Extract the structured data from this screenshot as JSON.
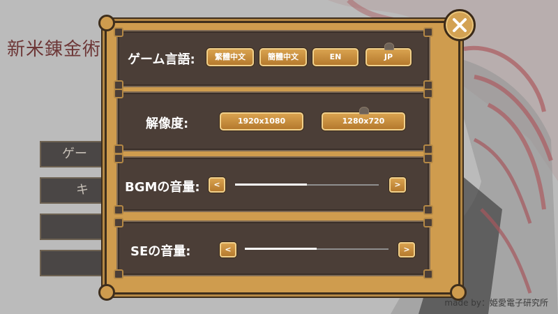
{
  "background": {
    "title": "新米錬金術",
    "menu": [
      "ゲー",
      "キ",
      "",
      ""
    ],
    "credit": "made by：姫愛電子研究所"
  },
  "settings": {
    "language": {
      "label": "ゲーム言語:",
      "options": [
        "繁體中文",
        "簡體中文",
        "EN",
        "JP"
      ],
      "selected": "JP"
    },
    "resolution": {
      "label": "解像度:",
      "options": [
        "1920x1080",
        "1280x720"
      ],
      "selected": "1280x720"
    },
    "bgm": {
      "label": "BGMの音量:",
      "dec": "<",
      "inc": ">",
      "level": 0.5
    },
    "se": {
      "label": "SEの音量:",
      "dec": "<",
      "inc": ">",
      "level": 0.5
    }
  },
  "close_icon": "close-x-icon",
  "colors": {
    "frame": "#cf9c4e",
    "panel": "#4b3e37",
    "button": "#c98d3e",
    "text": "#ffffff"
  }
}
